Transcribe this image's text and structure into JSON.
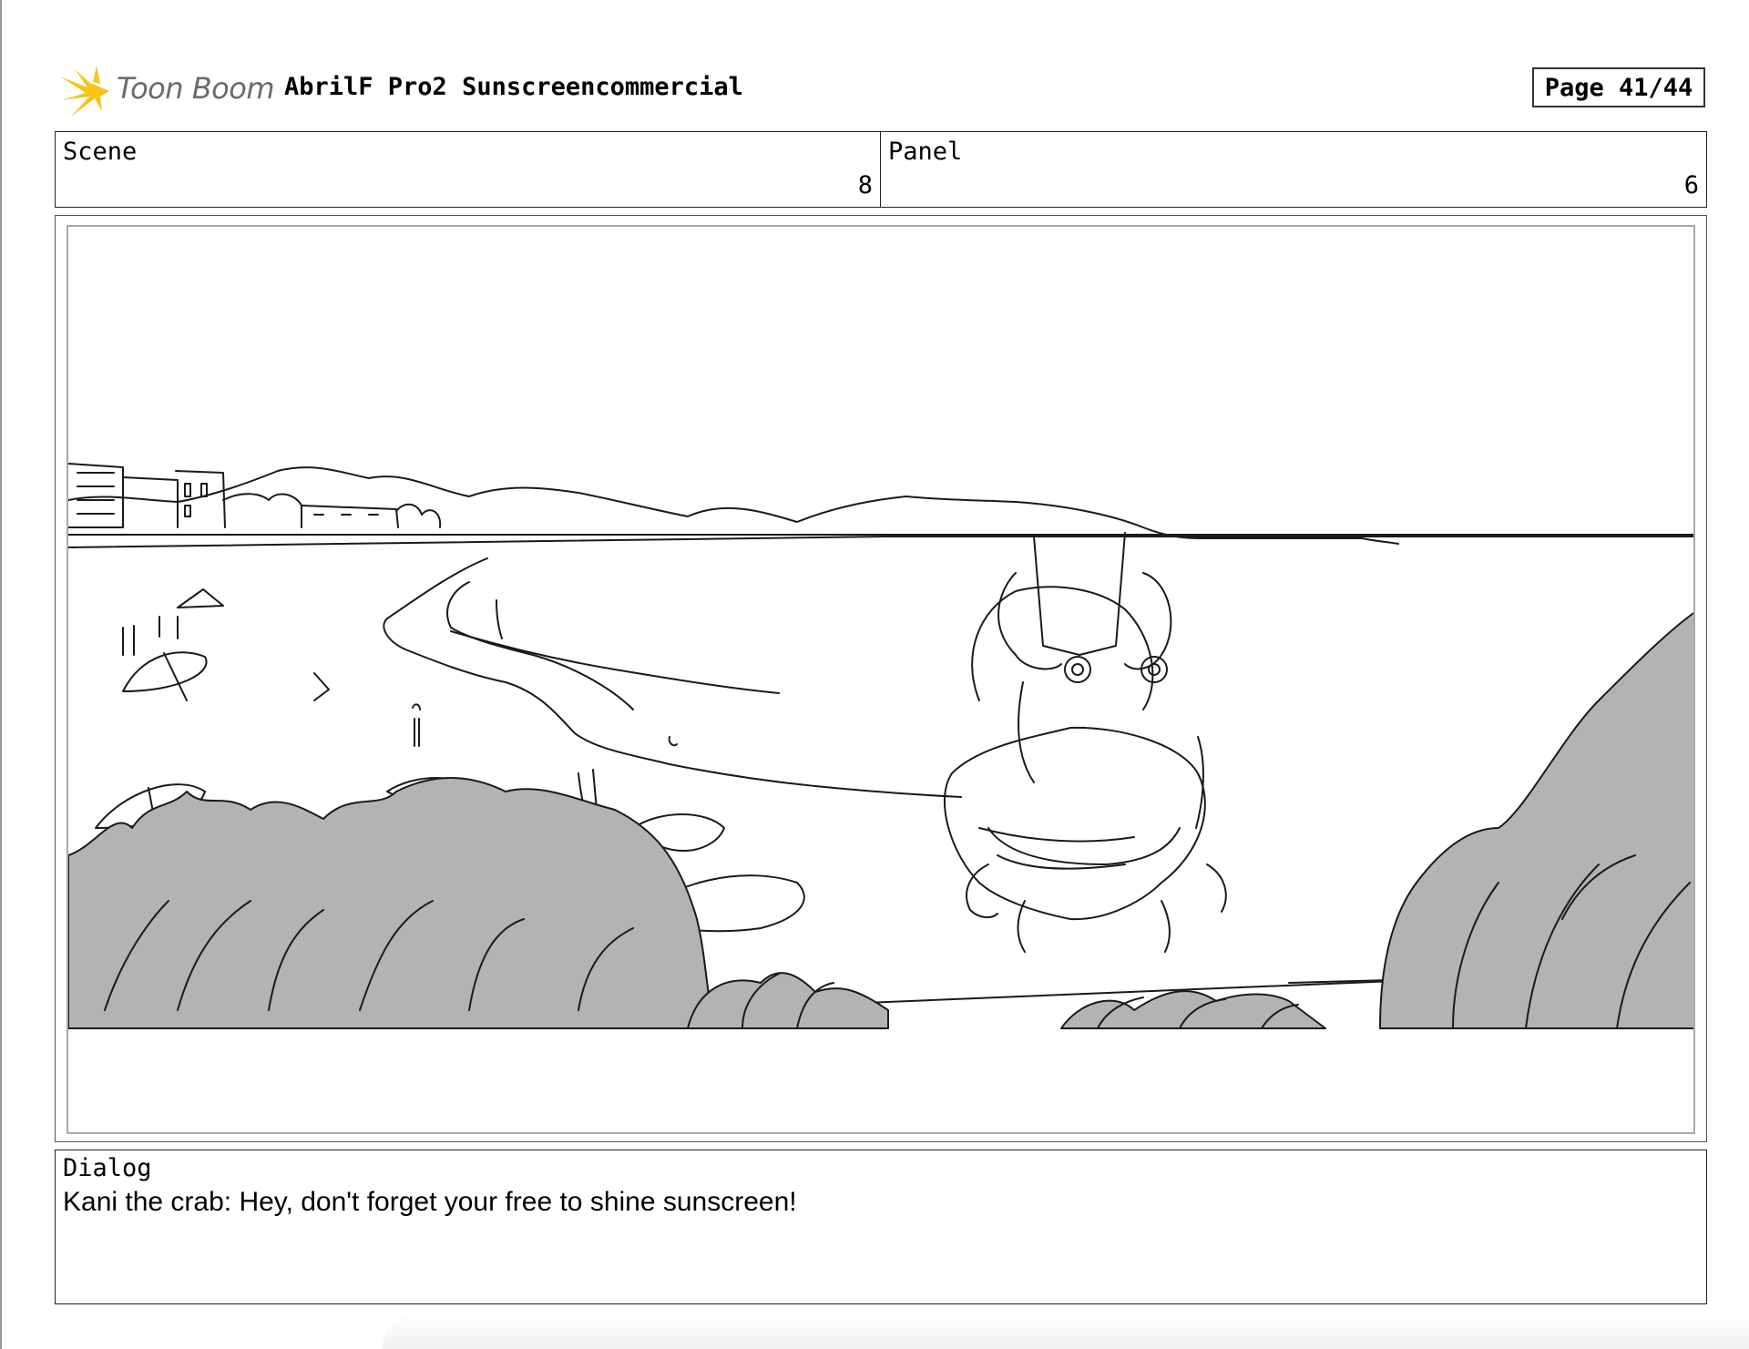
{
  "header": {
    "logo_text": "Toon Boom",
    "project_title": "AbrilF Pro2 Sunscreencommercial",
    "page": "Page 41/44"
  },
  "info": {
    "scene_label": "Scene",
    "scene_value": "8",
    "panel_label": "Panel",
    "panel_value": "6"
  },
  "panel_image": {
    "description_icon": "storyboard-sketch-beach-crab"
  },
  "dialog": {
    "label": "Dialog",
    "text": "Kani the crab: Hey,  don't forget your free to shine sunscreen!"
  },
  "colors": {
    "logo_star": "#f5c518",
    "logo_text": "#6b6b6b",
    "sketch_fill": "#b3b3b3",
    "sketch_line": "#1a1a1a"
  }
}
